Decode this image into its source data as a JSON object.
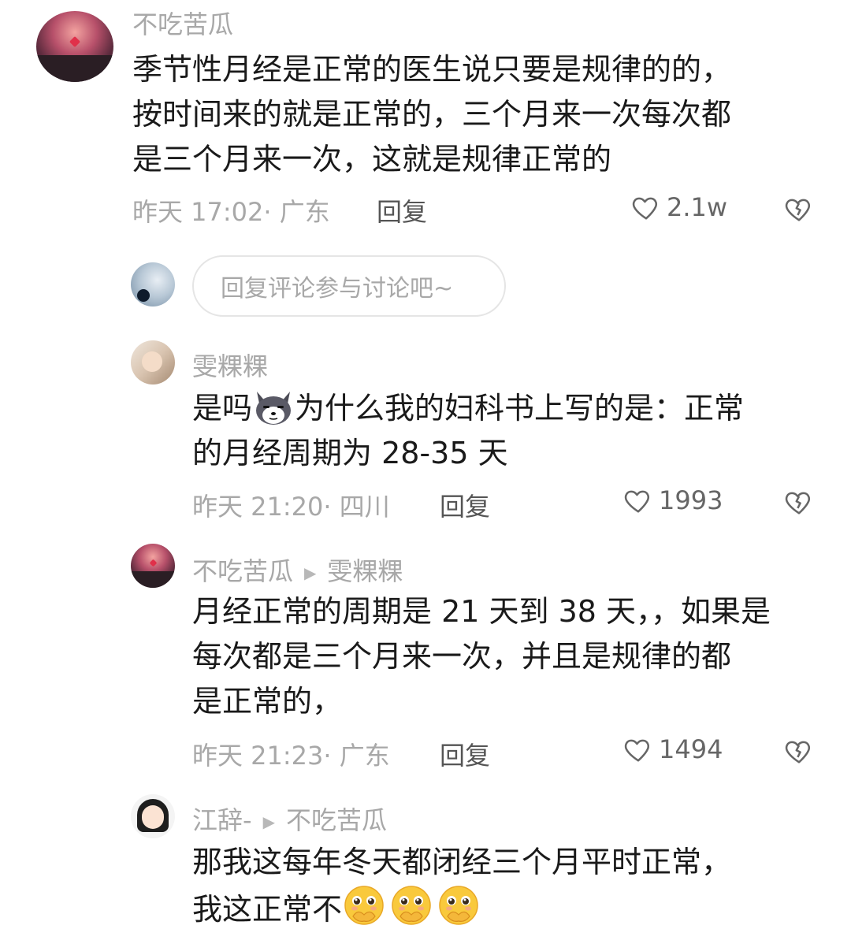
{
  "comments": [
    {
      "username": "不吃苦瓜",
      "text_lines": [
        "季节性月经是正常的医生说只要是规律的的，",
        "按时间来的就是正常的，三个月来一次每次都",
        "是三个月来一次，这就是规律正常的"
      ],
      "time": "昨天 17:02",
      "location": "广东",
      "reply_label": "回复",
      "likes": "2.1w"
    }
  ],
  "reply_input": {
    "placeholder": "回复评论参与讨论吧~"
  },
  "replies": [
    {
      "username": "雯粿粿",
      "text_before_emoji": "是吗",
      "text_after_emoji": "为什么我的妇科书上写的是：正常",
      "text_line2": "的月经周期为 28-35 天",
      "time": "昨天 21:20",
      "location": "四川",
      "reply_label": "回复",
      "likes": "1993"
    },
    {
      "username": "不吃苦瓜",
      "reply_to": "雯粿粿",
      "text_lines": [
        "月经正常的周期是 21 天到 38 天，，如果是",
        "每次都是三个月来一次，并且是规律的都",
        "是正常的，"
      ],
      "time": "昨天 21:23",
      "location": "广东",
      "reply_label": "回复",
      "likes": "1494"
    },
    {
      "username": "江辞-",
      "reply_to": "不吃苦瓜",
      "text_line1": "那我这每年冬天都闭经三个月平时正常，",
      "text_line2": "我这正常不",
      "emoji": "pleading-face-covering-mouth",
      "emoji_count": 3
    }
  ],
  "colors": {
    "text_primary": "#1a1a1a",
    "text_secondary": "#a8a8a8",
    "border": "#e5e5e5"
  },
  "icons": [
    "heart-outline-icon",
    "broken-heart-icon",
    "play-arrow-icon",
    "husky-emoji",
    "pleading-emoji"
  ]
}
